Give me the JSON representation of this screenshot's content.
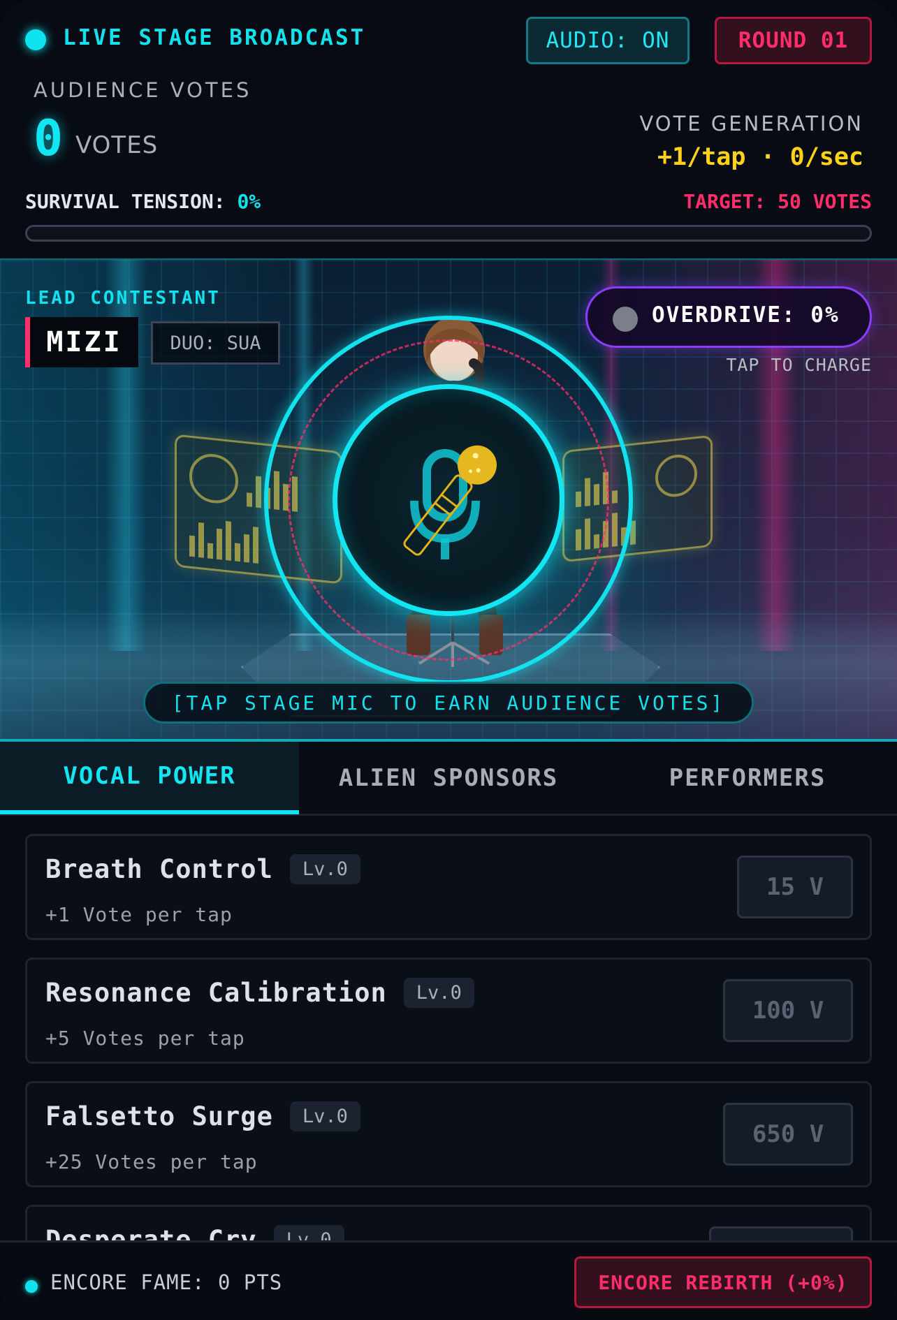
{
  "header": {
    "live_label": "LIVE STAGE BROADCAST",
    "audio_button": "AUDIO: ON",
    "round_button": "ROUND 01",
    "audience_label": "AUDIENCE VOTES",
    "votes_value": "0",
    "votes_unit": "VOTES",
    "generation_label": "VOTE GENERATION",
    "generation_value": "+1/tap · 0/sec",
    "tension_label": "SURVIVAL TENSION:",
    "tension_value": "0%",
    "tension_fraction": 0,
    "target": "TARGET: 50 VOTES"
  },
  "stage": {
    "lead_label": "LEAD CONTESTANT",
    "lead_name": "MIZI",
    "duo": "DUO: SUA",
    "overdrive": "OVERDRIVE: 0%",
    "overdrive_hint": "TAP TO CHARGE",
    "tap_hint": "[TAP STAGE MIC TO EARN AUDIENCE VOTES]"
  },
  "tabs": [
    {
      "label": "VOCAL POWER",
      "active": true
    },
    {
      "label": "ALIEN SPONSORS",
      "active": false
    },
    {
      "label": "PERFORMERS",
      "active": false
    }
  ],
  "upgrades": [
    {
      "name": "Breath Control",
      "level": "Lv.0",
      "desc": "+1 Vote per tap",
      "cost": "15 V"
    },
    {
      "name": "Resonance Calibration",
      "level": "Lv.0",
      "desc": "+5 Votes per tap",
      "cost": "100 V"
    },
    {
      "name": "Falsetto Surge",
      "level": "Lv.0",
      "desc": "+25 Votes per tap",
      "cost": "650 V"
    },
    {
      "name": "Desperate Cry",
      "level": "Lv.0",
      "desc": "",
      "cost": ""
    }
  ],
  "footer": {
    "fame": "ENCORE FAME: 0 PTS",
    "rebirth": "ENCORE REBIRTH (+0%)"
  },
  "colors": {
    "accent": "#12e2ee",
    "danger": "#ff2e6a",
    "gold": "#ffd21a",
    "overdrive": "#8a3cff"
  }
}
